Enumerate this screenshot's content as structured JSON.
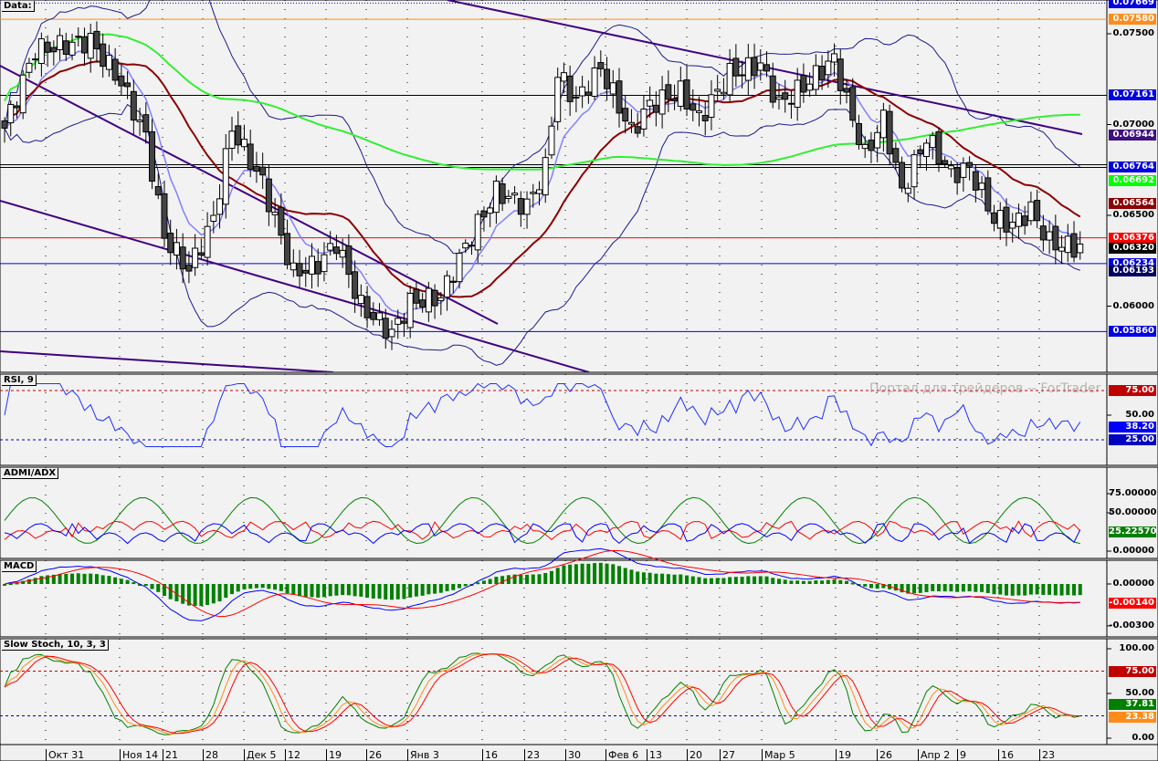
{
  "panels": {
    "main": {
      "title": "Data:",
      "ticks": [
        {
          "v": 0.075,
          "t": "0.07500"
        },
        {
          "v": 0.07,
          "t": "0.07000"
        },
        {
          "v": 0.065,
          "t": "0.06500"
        },
        {
          "v": 0.06,
          "t": "0.06000"
        }
      ],
      "tags": [
        {
          "v": 0.07669,
          "t": "0.07669",
          "bg": "#0000e0"
        },
        {
          "v": 0.0758,
          "t": "0.07580",
          "bg": "#ff8c1a"
        },
        {
          "v": 0.07161,
          "t": "0.07161",
          "bg": "#0000e0"
        },
        {
          "v": 0.06944,
          "t": "0.06944",
          "bg": "#3f0f7f"
        },
        {
          "v": 0.06764,
          "t": "0.06764",
          "bg": "#0000e0"
        },
        {
          "v": 0.06692,
          "t": "0.06692",
          "bg": "#00ff00"
        },
        {
          "v": 0.06564,
          "t": "0.06564",
          "bg": "#8b0000"
        },
        {
          "v": 0.06376,
          "t": "0.06376",
          "bg": "#ff0000"
        },
        {
          "v": 0.0632,
          "t": "0.06320",
          "bg": "#000000"
        },
        {
          "v": 0.06234,
          "t": "0.06234",
          "bg": "#0000e0"
        },
        {
          "v": 0.06193,
          "t": "0.06193",
          "bg": "#000060"
        },
        {
          "v": 0.0586,
          "t": "0.05860",
          "bg": "#0000e0"
        }
      ]
    },
    "rsi": {
      "title": "RSI, 9",
      "ticks": [
        {
          "v": 50,
          "t": "50.00"
        }
      ],
      "tags": [
        {
          "v": 75,
          "t": "75.00",
          "bg": "#c00000"
        },
        {
          "v": 38.2,
          "t": "38.20",
          "bg": "#0000ff"
        },
        {
          "v": 25,
          "t": "25.00",
          "bg": "#0000c0"
        }
      ]
    },
    "adx": {
      "title": "ADMI/ADX",
      "ticks": [
        {
          "v": 75,
          "t": "75.00000"
        },
        {
          "v": 50,
          "t": "50.00000"
        },
        {
          "v": 0,
          "t": "0.00000"
        }
      ],
      "tags": [
        {
          "v": 25.2257,
          "t": "25.22570",
          "bg": "#007f00"
        }
      ]
    },
    "macd": {
      "title": "MACD",
      "ticks": [
        {
          "v": 0,
          "t": "0.00000"
        },
        {
          "v": -0.003,
          "t": "-0.00300"
        }
      ],
      "tags": [
        {
          "v": -0.0014,
          "t": "-0.00140",
          "bg": "#ff0000"
        }
      ]
    },
    "stoch": {
      "title": "Slow Stoch, 10, 3, 3",
      "ticks": [
        {
          "v": 100,
          "t": "100.00"
        },
        {
          "v": 50,
          "t": "50.00"
        },
        {
          "v": 0,
          "t": "0.00"
        }
      ],
      "tags": [
        {
          "v": 75,
          "t": "75.00",
          "bg": "#c00000"
        },
        {
          "v": 37.81,
          "t": "37.81",
          "bg": "#007f00"
        },
        {
          "v": 23.38,
          "t": "23.38",
          "bg": "#ff8c1a"
        }
      ]
    }
  },
  "watermark": "Портал для трейдеров -- ForTrader",
  "x_axis": [
    "Окт 31",
    "Ноя 14",
    "21",
    "28",
    "Дек 5",
    "12",
    "19",
    "26",
    "Янв 3",
    "16",
    "23",
    "30",
    "Фев 6",
    "13",
    "20",
    "27",
    "Мар 5",
    "19",
    "26",
    "Апр 2",
    "9",
    "16",
    "23"
  ],
  "chart_data": {
    "type": "candlestick",
    "bars": 176,
    "close_anchors": [
      [
        0,
        0.0698
      ],
      [
        5,
        0.0741
      ],
      [
        14,
        0.0746
      ],
      [
        19,
        0.0723
      ],
      [
        23,
        0.0693
      ],
      [
        26,
        0.0638
      ],
      [
        30,
        0.062
      ],
      [
        34,
        0.0648
      ],
      [
        37,
        0.0698
      ],
      [
        42,
        0.0668
      ],
      [
        45,
        0.0638
      ],
      [
        47,
        0.0618
      ],
      [
        51,
        0.0623
      ],
      [
        54,
        0.0635
      ],
      [
        58,
        0.06
      ],
      [
        63,
        0.0585
      ],
      [
        66,
        0.0602
      ],
      [
        71,
        0.0605
      ],
      [
        75,
        0.0633
      ],
      [
        80,
        0.0663
      ],
      [
        85,
        0.0655
      ],
      [
        88,
        0.0676
      ],
      [
        90,
        0.0728
      ],
      [
        93,
        0.0713
      ],
      [
        97,
        0.0731
      ],
      [
        102,
        0.0696
      ],
      [
        105,
        0.0711
      ],
      [
        110,
        0.0718
      ],
      [
        113,
        0.0703
      ],
      [
        118,
        0.0728
      ],
      [
        123,
        0.0733
      ],
      [
        126,
        0.0711
      ],
      [
        130,
        0.0721
      ],
      [
        135,
        0.0736
      ],
      [
        137,
        0.0713
      ],
      [
        140,
        0.0683
      ],
      [
        143,
        0.0703
      ],
      [
        146,
        0.0663
      ],
      [
        150,
        0.0693
      ],
      [
        154,
        0.0673
      ],
      [
        157,
        0.0676
      ],
      [
        161,
        0.0648
      ],
      [
        164,
        0.0645
      ],
      [
        167,
        0.0653
      ],
      [
        170,
        0.0635
      ],
      [
        175,
        0.0632
      ]
    ],
    "horizontal_levels": [
      0.07669,
      0.0758,
      0.07161,
      0.06764,
      0.06376,
      0.06234,
      0.0586
    ],
    "ylim": [
      0.0571,
      0.077
    ],
    "indicators": [
      "Bollinger Bands",
      "SMA",
      "RSI 9",
      "ADMI/ADX",
      "MACD",
      "Slow Stoch 10,3,3"
    ]
  }
}
